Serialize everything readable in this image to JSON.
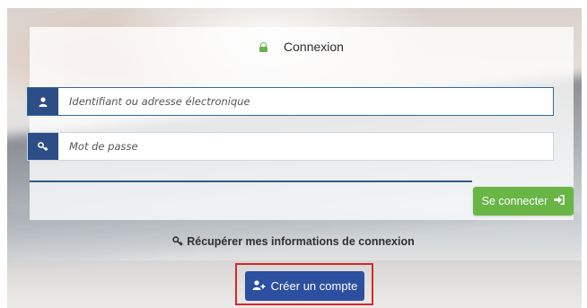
{
  "login_card": {
    "title": "Connexion",
    "title_icon": "lock-icon",
    "username": {
      "placeholder": "Identifiant ou adresse électronique",
      "value": "",
      "icon": "user-icon"
    },
    "password": {
      "placeholder": "Mot de passe",
      "value": "",
      "icon": "key-icon"
    },
    "submit_label": "Se connecter",
    "submit_icon": "sign-in-icon"
  },
  "recover_link": {
    "label": "Récupérer mes informations de connexion",
    "icon": "key-icon"
  },
  "create_account": {
    "label": "Créer un compte",
    "icon": "add-user-icon"
  },
  "colors": {
    "primary_blue": "#2d4d86",
    "button_blue": "#2d4fa0",
    "success_green": "#69b647",
    "highlight_red": "#d42a2a"
  }
}
